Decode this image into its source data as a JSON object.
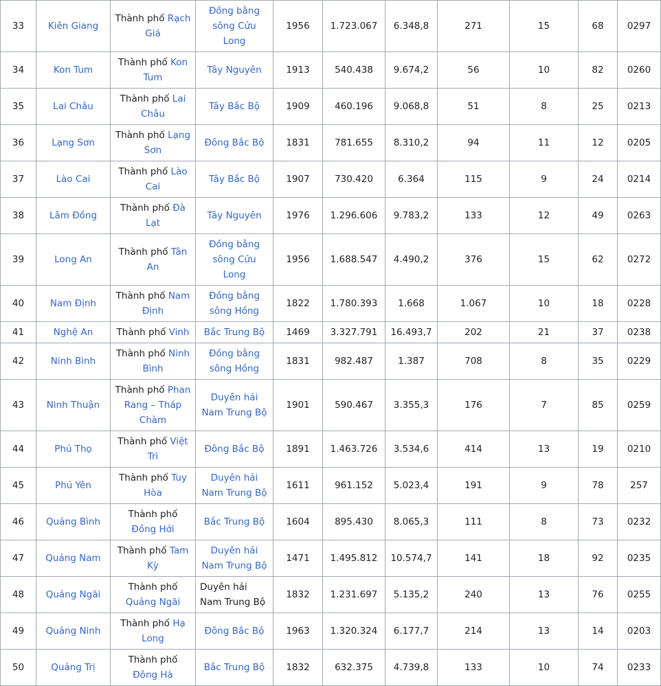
{
  "rows": [
    {
      "no": "33",
      "province": "Kiên Giang",
      "capital_prefix": "Thành phố ",
      "capital_link": "Rạch Giá",
      "region": "Đồng bằng sông Cửu Long",
      "region_link": true,
      "year": "1956",
      "population": "1.723.067",
      "area": "6.348,8",
      "density": "271",
      "units": "15",
      "plate": "68",
      "phone": "0297",
      "h": 51
    },
    {
      "no": "34",
      "province": "Kon Tum",
      "capital_prefix": "Thành phố ",
      "capital_link": "Kon Tum",
      "region": "Tây Nguyên",
      "region_link": true,
      "year": "1913",
      "population": "540.438",
      "area": "9.674,2",
      "density": "56",
      "units": "10",
      "plate": "82",
      "phone": "0260",
      "h": 52
    },
    {
      "no": "35",
      "province": "Lai Châu",
      "capital_prefix": "Thành phố ",
      "capital_link": "Lai Châu",
      "region": "Tây Bắc Bộ",
      "region_link": true,
      "year": "1909",
      "population": "460.196",
      "area": "9.068,8",
      "density": "51",
      "units": "8",
      "plate": "25",
      "phone": "0213",
      "h": 51
    },
    {
      "no": "36",
      "province": "Lạng Sơn",
      "capital_prefix": "Thành phố ",
      "capital_link": "Lạng Sơn",
      "region": "Đông Bắc Bộ",
      "region_link": true,
      "year": "1831",
      "population": "781.655",
      "area": "8.310,2",
      "density": "94",
      "units": "11",
      "plate": "12",
      "phone": "0205",
      "h": 52
    },
    {
      "no": "37",
      "province": "Lào Cai",
      "capital_prefix": "Thành phố ",
      "capital_link": "Lào Cai",
      "region": "Tây Bắc Bộ",
      "region_link": true,
      "year": "1907",
      "population": "730.420",
      "area": "6.364",
      "density": "115",
      "units": "9",
      "plate": "24",
      "phone": "0214",
      "h": 51
    },
    {
      "no": "38",
      "province": "Lâm Đồng",
      "capital_prefix": "Thành phố ",
      "capital_link": "Đà Lạt",
      "region": "Tây Nguyên",
      "region_link": true,
      "year": "1976",
      "population": "1.296.606",
      "area": "9.783,2",
      "density": "133",
      "units": "12",
      "plate": "49",
      "phone": "0263",
      "h": 29
    },
    {
      "no": "39",
      "province": "Long An",
      "capital_prefix": "Thành phố ",
      "capital_link": "Tân An",
      "region": "Đồng bằng sông Cửu Long",
      "region_link": true,
      "year": "1956",
      "population": "1.688.547",
      "area": "4.490,2",
      "density": "376",
      "units": "15",
      "plate": "62",
      "phone": "0272",
      "h": 51
    },
    {
      "no": "40",
      "province": "Nam Định",
      "capital_prefix": "Thành phố ",
      "capital_link": "Nam Định",
      "region": "Đồng bằng sông Hồng",
      "region_link": true,
      "year": "1822",
      "population": "1.780.393",
      "area": "1.668",
      "density": "1.067",
      "units": "10",
      "plate": "18",
      "phone": "0228",
      "h": 51
    },
    {
      "no": "41",
      "province": "Nghệ An",
      "capital_prefix": "Thành phố ",
      "capital_link": "Vinh",
      "region": "Bắc Trung Bộ",
      "region_link": true,
      "year": "1469",
      "population": "3.327.791",
      "area": "16.493,7",
      "density": "202",
      "units": "21",
      "plate": "37",
      "phone": "0238",
      "h": 29
    },
    {
      "no": "42",
      "province": "Ninh Bình",
      "capital_prefix": "Thành phố ",
      "capital_link": "Ninh Bình",
      "region": "Đồng bằng sông Hồng",
      "region_link": true,
      "year": "1831",
      "population": "982.487",
      "area": "1.387",
      "density": "708",
      "units": "8",
      "plate": "35",
      "phone": "0229",
      "h": 51
    },
    {
      "no": "43",
      "province": "Ninh Thuận",
      "capital_prefix": "Thành phố ",
      "capital_link": "Phan Rang – Tháp Chàm",
      "region": "Duyên hải Nam Trung Bộ",
      "region_link": true,
      "year": "1901",
      "population": "590.467",
      "area": "3.355,3",
      "density": "176",
      "units": "7",
      "plate": "85",
      "phone": "0259",
      "h": 74
    },
    {
      "no": "44",
      "province": "Phú Thọ",
      "capital_prefix": "Thành phố ",
      "capital_link": "Việt Trì",
      "region": "Đông Bắc Bộ",
      "region_link": true,
      "year": "1891",
      "population": "1.463.726",
      "area": "3.534,6",
      "density": "414",
      "units": "13",
      "plate": "19",
      "phone": "0210",
      "h": 51
    },
    {
      "no": "45",
      "province": "Phú Yên",
      "capital_prefix": "Thành phố ",
      "capital_link": "Tuy Hòa",
      "region": "Duyên hải Nam Trung Bộ",
      "region_link": true,
      "year": "1611",
      "population": "961.152",
      "area": "5.023,4",
      "density": "191",
      "units": "9",
      "plate": "78",
      "phone": "257",
      "h": 52
    },
    {
      "no": "46",
      "province": "Quảng Bình",
      "capital_prefix": "Thành phố ",
      "capital_link": "Đồng Hới",
      "region": "Bắc Trung Bộ",
      "region_link": true,
      "year": "1604",
      "population": "895.430",
      "area": "8.065,3",
      "density": "111",
      "units": "8",
      "plate": "73",
      "phone": "0232",
      "h": 51
    },
    {
      "no": "47",
      "province": "Quảng Nam",
      "capital_prefix": "Thành phố ",
      "capital_link": "Tam Kỳ",
      "region": "Duyên hải Nam Trung Bộ",
      "region_link": true,
      "year": "1471",
      "population": "1.495.812",
      "area": "10.574,7",
      "density": "141",
      "units": "18",
      "plate": "92",
      "phone": "0235",
      "h": 52
    },
    {
      "no": "48",
      "province": "Quảng Ngãi",
      "capital_prefix": "Thành phố ",
      "capital_link": "Quảng Ngãi",
      "region": "Duyên hải Nam Trung Bộ",
      "region_link": false,
      "year": "1832",
      "population": "1.231.697",
      "area": "5.135,2",
      "density": "240",
      "units": "13",
      "plate": "76",
      "phone": "0255",
      "h": 51
    },
    {
      "no": "49",
      "province": "Quảng Ninh",
      "capital_prefix": "Thành phố ",
      "capital_link": "Hạ Long",
      "region": "Đông Bắc Bộ",
      "region_link": true,
      "year": "1963",
      "population": "1.320.324",
      "area": "6.177,7",
      "density": "214",
      "units": "13",
      "plate": "14",
      "phone": "0203",
      "h": 52
    },
    {
      "no": "50",
      "province": "Quảng Trị",
      "capital_prefix": "Thành phố ",
      "capital_link": "Đông Hà",
      "region": "Bắc Trung Bộ",
      "region_link": true,
      "year": "1832",
      "population": "632.375",
      "area": "4.739,8",
      "density": "133",
      "units": "10",
      "plate": "74",
      "phone": "0233",
      "h": 52
    }
  ]
}
